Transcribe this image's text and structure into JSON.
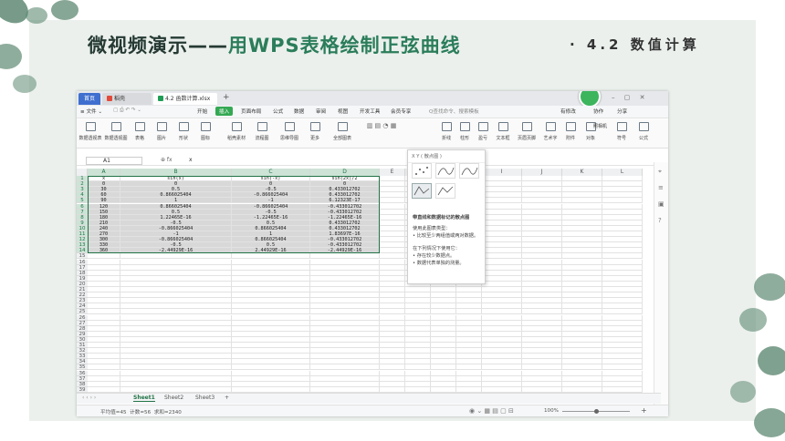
{
  "slide": {
    "title_main": "微视频演示——",
    "title_accent": "用WPS表格绘制正弦曲线",
    "section": "· 4.2 数值计算"
  },
  "window": {
    "tabs": [
      {
        "label": "首页"
      },
      {
        "label": "稻壳"
      },
      {
        "label": "4.2 函数计算.xlsx"
      }
    ],
    "new_tab": "+",
    "controls": "– ▢ ✕",
    "menu": {
      "file": "≡ 文件 ⌄",
      "items": [
        "开始",
        "插入",
        "页面布局",
        "公式",
        "数据",
        "审阅",
        "视图",
        "开发工具",
        "会员专享"
      ],
      "search": "Q查找命令、搜索模板",
      "right": [
        "有修改",
        "协作",
        "分享"
      ]
    },
    "toolbar": [
      {
        "label": "数据透视表",
        "icon": "pivot-table-icon"
      },
      {
        "label": "数据透视图",
        "icon": "pivot-chart-icon"
      },
      {
        "label": "表格",
        "icon": "table-icon"
      },
      {
        "label": "图片",
        "icon": "picture-icon"
      },
      {
        "label": "形状",
        "icon": "shape-icon"
      },
      {
        "label": "图标",
        "icon": "icon-library-icon"
      },
      {
        "label": "稻壳素材",
        "icon": "material-icon"
      },
      {
        "label": "流程图",
        "icon": "flowchart-icon"
      },
      {
        "label": "思维导图",
        "icon": "mindmap-icon"
      },
      {
        "label": "更多",
        "icon": "more-icon"
      },
      {
        "label": "全部图表",
        "icon": "all-charts-icon"
      },
      {
        "label": "折线",
        "icon": "line-chart-icon"
      },
      {
        "label": "柱形",
        "icon": "column-chart-icon"
      },
      {
        "label": "盈亏",
        "icon": "winloss-chart-icon"
      },
      {
        "label": "文本框",
        "icon": "textbox-icon"
      },
      {
        "label": "页眉页脚",
        "icon": "header-footer-icon"
      },
      {
        "label": "艺术字",
        "icon": "wordart-icon"
      },
      {
        "label": "附件",
        "icon": "attachment-icon"
      },
      {
        "label": "对象",
        "icon": "object-icon"
      },
      {
        "label": "符号",
        "icon": "symbol-icon"
      },
      {
        "label": "公式",
        "icon": "formula-icon"
      }
    ],
    "right_tools": [
      "照相机"
    ],
    "formula_bar": {
      "cell": "A1",
      "fx": "⊕ fx",
      "value": "x"
    },
    "columns": [
      "A",
      "B",
      "C",
      "D",
      "E",
      "F",
      "G",
      "H",
      "I",
      "J",
      "K",
      "L"
    ],
    "headers": [
      "x",
      "sin(x)",
      "sin(-x)",
      "sin(2x)/2"
    ],
    "rows": [
      [
        "0",
        "0",
        "0",
        "0"
      ],
      [
        "30",
        "0.5",
        "-0.5",
        "0.433012702"
      ],
      [
        "60",
        "0.866025404",
        "-0.866025404",
        "0.433012702"
      ],
      [
        "90",
        "1",
        "-1",
        "6.12323E-17"
      ],
      [
        "120",
        "0.866025404",
        "-0.866025404",
        "-0.433012702"
      ],
      [
        "150",
        "0.5",
        "-0.5",
        "-0.433012702"
      ],
      [
        "180",
        "1.22465E-16",
        "-1.22465E-16",
        "-1.22465E-16"
      ],
      [
        "210",
        "-0.5",
        "0.5",
        "0.433012702"
      ],
      [
        "240",
        "-0.866025404",
        "0.866025404",
        "0.433012702"
      ],
      [
        "270",
        "-1",
        "1",
        "1.83697E-16"
      ],
      [
        "300",
        "-0.866025404",
        "0.866025404",
        "-0.433012702"
      ],
      [
        "330",
        "-0.5",
        "0.5",
        "-0.433012702"
      ],
      [
        "360",
        "-2.44929E-16",
        "2.44929E-16",
        "-2.44929E-16"
      ]
    ],
    "row_count": 40,
    "scatter_popup": {
      "header": "X Y ( 散点图 )",
      "desc_title": "带直线和数据标记的散点图",
      "desc_lines": [
        "使用此图表类型：",
        "• 比较至少两组值或两对数据。",
        "",
        "在下列情况下使用它：",
        "• 存在较少数据点。",
        "• 数据代表单独的测量。"
      ]
    },
    "sheets": [
      "Sheet1",
      "Sheet2",
      "Sheet3"
    ],
    "add_sheet": "+",
    "status": {
      "average": "平均值=45",
      "count": "计数=56",
      "sum": "求和=2340",
      "zoom": "100%",
      "zoom_level": 0.5
    }
  }
}
